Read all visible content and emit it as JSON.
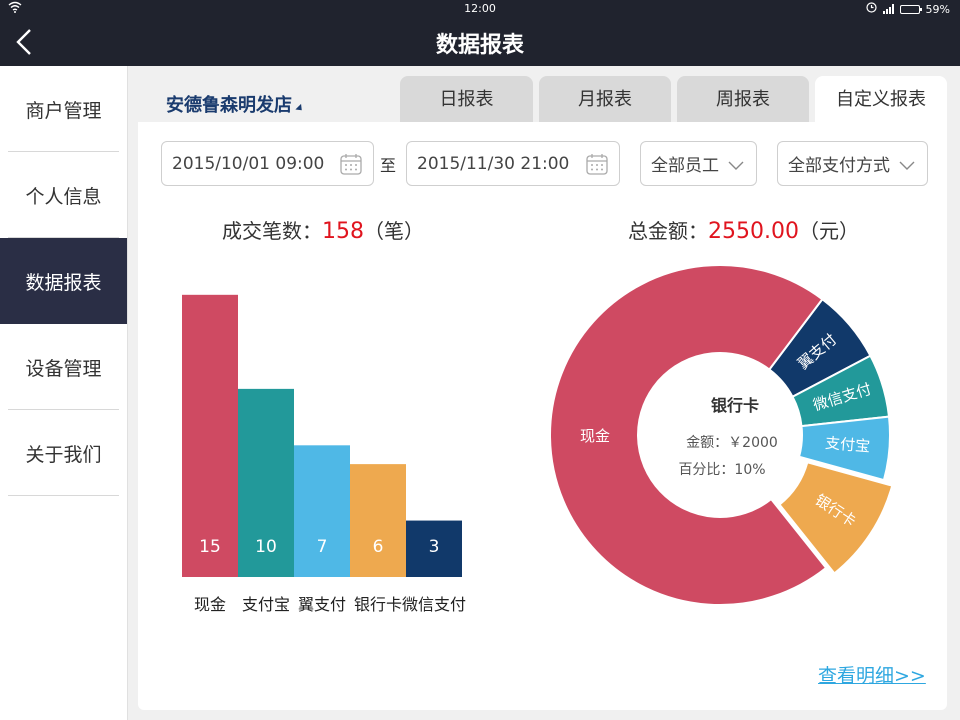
{
  "status": {
    "time": "12:00",
    "battery": "59%",
    "battery_level": 0.59
  },
  "nav": {
    "title": "数据报表"
  },
  "sidebar": {
    "items": [
      {
        "label": "商户管理"
      },
      {
        "label": "个人信息"
      },
      {
        "label": "数据报表",
        "active": true
      },
      {
        "label": "设备管理"
      },
      {
        "label": "关于我们"
      }
    ]
  },
  "store": {
    "name": "安德鲁森明发店"
  },
  "tabs": [
    {
      "label": "日报表"
    },
    {
      "label": "月报表"
    },
    {
      "label": "周报表"
    },
    {
      "label": "自定义报表",
      "active": true
    }
  ],
  "filters": {
    "start": "2015/10/01 09:00",
    "to": "至",
    "end": "2015/11/30 21:00",
    "staff": "全部员工",
    "payment": "全部支付方式"
  },
  "summary": {
    "count_label": "成交笔数：",
    "count_value": "158",
    "count_unit": "（笔）",
    "amount_label": "总金额：",
    "amount_value": "2550.00",
    "amount_unit": "（元）"
  },
  "colors": {
    "cash": "#cf4a62",
    "alipay": "#22999a",
    "yizhifu": "#4fb8e6",
    "bankcard": "#eea94f",
    "wechat": "#11396a",
    "highlight": "#e0141e",
    "link": "#2ea7e0"
  },
  "chart_data": [
    {
      "type": "bar",
      "categories": [
        "现金",
        "支付宝",
        "翼支付",
        "银行卡",
        "微信支付"
      ],
      "values": [
        15,
        10,
        7,
        6,
        3
      ],
      "value_labels": [
        "15",
        "10",
        "7",
        "6",
        "3"
      ],
      "ylim": [
        0,
        16
      ],
      "grid": false
    },
    {
      "type": "pie",
      "labels": [
        "翼支付",
        "微信支付",
        "支付宝",
        "银行卡",
        "现金"
      ],
      "values": [
        0.07,
        0.06,
        0.06,
        0.1,
        0.71
      ],
      "exploded": "银行卡",
      "center": {
        "title": "银行卡",
        "amount": "金额：￥2000",
        "percent": "百分比：10%"
      }
    }
  ],
  "link": {
    "detail": "查看明细>>"
  }
}
